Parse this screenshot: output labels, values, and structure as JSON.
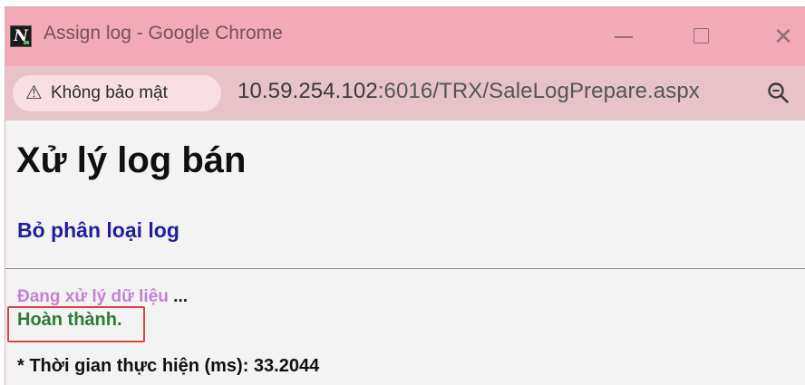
{
  "window": {
    "title": "Assign log - Google Chrome",
    "app_icon_letter": "N",
    "controls": {
      "minimize_icon": "minimize-icon",
      "maximize_icon": "maximize-icon",
      "close_icon": "close-icon",
      "close_glyph": "✕"
    }
  },
  "addressbar": {
    "security_chip_icon": "warning-icon",
    "security_chip_glyph": "⚠",
    "security_chip_label": "Không bảo mật",
    "url_host": "10.59.254.102",
    "url_path": ":6016/TRX/SaleLogPrepare.aspx",
    "zoom_icon": "zoom-icon"
  },
  "page": {
    "title": "Xử lý log bán",
    "link_label": "Bỏ phân loại log",
    "processing_text": "Đang xử lý dữ liệu",
    "processing_dots": " ...",
    "done_text": "Hoàn thành.",
    "exec_time_text": "* Thời gian thực hiện (ms): 33.2044"
  },
  "colors": {
    "titlebar": "#f2a9b8",
    "addressbar": "#e7c2c9",
    "link": "#1f1f9a",
    "processing": "#c681d4",
    "done": "#2e7a35",
    "highlight_box": "#d64545"
  }
}
